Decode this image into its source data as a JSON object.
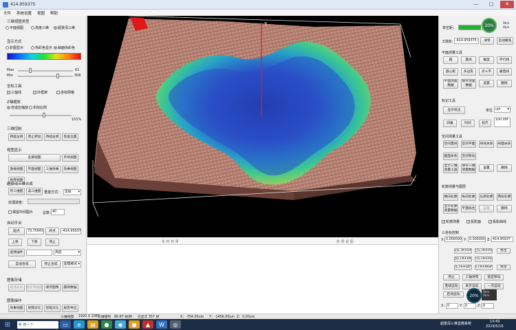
{
  "window": {
    "title": "414.959375",
    "minimize_glyph": "—",
    "maximize_glyph": "□",
    "close_glyph": "✕"
  },
  "menu": [
    "文件",
    "系统设置",
    "视图",
    "帮助"
  ],
  "left": {
    "display_type": {
      "title": "三维视图类型",
      "options": [
        "平面视图",
        "高度三维",
        "超景深三维"
      ],
      "selected": 2
    },
    "display_mode": {
      "title": "显示方式",
      "options": [
        "彩图显示",
        "伪彩色显示",
        "曲面伪彩色"
      ],
      "selected": 2,
      "max_label": "Max",
      "max_value": "61",
      "min_label": "Min",
      "min_value": "306"
    },
    "axis_tools": {
      "title": "坐标工具",
      "checks": [
        {
          "label": "三轴线",
          "checked": true
        },
        {
          "label": "外框架",
          "checked": true
        },
        {
          "label": "坐标网格",
          "checked": false
        }
      ]
    },
    "z_scale": {
      "title": "Z轴缩放",
      "options": [
        "自适应缩放",
        "实际比例"
      ],
      "selected": 0,
      "value": "151%"
    },
    "view3d": {
      "title": "三维控制",
      "buttons": [
        "持续左转",
        "停止转动",
        "持续右转",
        "恢复位置"
      ]
    },
    "view_display": {
      "title": "视图显示",
      "buttons": [
        "全部视图",
        "放缩视图",
        "手绘视图",
        "平面视图",
        "视频视图",
        "三维效果",
        "效果视图"
      ]
    },
    "depth": {
      "title": "超景深三维合成",
      "btn_save": "存三维图",
      "btn_load": "读三维图",
      "mode_label": "重建方式：",
      "mode_value": "常规",
      "progress_label": "处理进度：",
      "keep_label": "保留中间图片",
      "count_label": "总数：",
      "count_value": "40"
    },
    "auto_stage": {
      "title": "自动平台",
      "up": "上移",
      "down": "下移",
      "stop": "停止",
      "start_label": "起点",
      "start_value": "73.756437",
      "end_label": "终点",
      "end_value": "-414.95937",
      "select_label": "选择插件",
      "select_value": "高度",
      "auto_compose": "自动合成",
      "stop_compose": "停止合成",
      "speed_label": "超慢模式"
    },
    "image_save": {
      "title": "图像存储",
      "buttons": [
        "现场实时",
        "保存原视图",
        "保存图像",
        "删除数据"
      ]
    },
    "image_ops": {
      "title": "图像操作",
      "buttons": [
        "效果视图",
        "视频对比",
        "智能对比",
        "报告导出"
      ]
    }
  },
  "viewport": {
    "axis_label": "Y",
    "status_left": "实 时 效 果",
    "status_right": "效 果 视 图"
  },
  "right": {
    "zoom_label": "单空距：",
    "zoom_percent": "20%",
    "rate_up": "0k/s",
    "rate_down": "0k/s",
    "meas_label": "Z测高：",
    "meas_value": "-414.959375 um",
    "clear_btn": "清零",
    "auto_btn": "自动聚焦",
    "plane_title": "平面测量工具",
    "plane_buttons": [
      "圆",
      "直线",
      "角度",
      "平行线",
      "圆心距",
      "多边形",
      "点十字",
      "垂直线",
      "平面测量数据",
      "保存测量数据",
      "设置",
      "删除"
    ],
    "mark_title": "标记工具",
    "mark_btn": "显示标注",
    "unit_label": "单位",
    "unit_value": "um",
    "height_label": "100 um",
    "mark_buttons": [
      "四角",
      "时间",
      "标尺"
    ],
    "space_title": "空间测量工具",
    "space_buttons": [
      "空间直线",
      "空间平面",
      "线线关系",
      "线面关系",
      "面面关系",
      "空间移动",
      "显示三维测量工具",
      "保存三维测量数据",
      "设置",
      "删除"
    ],
    "profile_title": "轮廓测量与图层",
    "profile_buttons": [
      "横向轮廓",
      "纵向轮廓",
      "任意轮廓",
      "两段轮廓",
      "显示轮廓测量数据",
      "平面拟合",
      "设置",
      "删除"
    ],
    "profile_checks": [
      {
        "label": "轮廓测量",
        "checked": true
      },
      {
        "label": "投影面",
        "checked": true
      },
      {
        "label": "投影曲线",
        "checked": true
      }
    ],
    "coord_title": "三坐标控制",
    "x_label": "X:",
    "x_value": "0.000000",
    "y_label": "Y:",
    "y_value": "0.000000",
    "z_label": "Z:",
    "z_value": "414.95937",
    "coord_buttons": [
      "前(CTR+UP)",
      "上(CTR+PU)",
      "后(CTR+DN)",
      "下(CTR+PD)",
      "左(CTR+LEFT)",
      "右(CTR+RIGHT)"
    ],
    "move_buttons": [
      "停止",
      "三轴清零",
      "指定移动"
    ],
    "bottom_buttons": [
      "连续运动",
      "单步运动",
      "一次运动",
      "启动运动"
    ],
    "go_label": "移至",
    "bottom_x": "0",
    "bottom_y": "0",
    "bottom_z": "0",
    "gauge_percent": "20%",
    "gauge_up": "0k/s",
    "gauge_down": "0k/s"
  },
  "statusbar": [
    "三维视图",
    "1920 X 1080",
    "三维建构",
    "66.67 帧/秒",
    "已显示 357 帧",
    "X：-704.00um",
    "Y：-1456.00um",
    "Z：0.00um"
  ],
  "taskbar": {
    "search": "搜一下",
    "app_title": "超景深三维显微系统",
    "time": "14:49",
    "date": "2019/5/16"
  },
  "colors": {
    "accent": "#1e50b4",
    "surface_copper": "#b87a6a",
    "progress_green": "#25b033"
  }
}
